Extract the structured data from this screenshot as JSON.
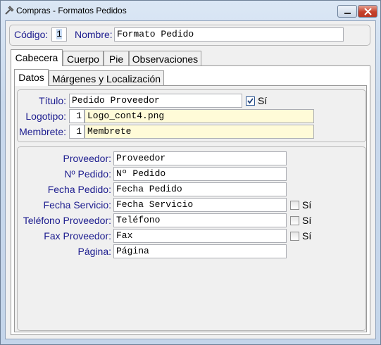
{
  "window": {
    "title": "Compras - Formatos Pedidos"
  },
  "header": {
    "codigo_label": "Código:",
    "codigo_value": "1",
    "nombre_label": "Nombre:",
    "nombre_value": "Formato Pedido"
  },
  "main_tabs": [
    "Cabecera",
    "Cuerpo",
    "Pie",
    "Observaciones"
  ],
  "sub_tabs": [
    "Datos",
    "Márgenes y Localización"
  ],
  "datos": {
    "titulo_label": "Título:",
    "titulo_value": "Pedido Proveedor",
    "titulo_check_label": "Sí",
    "titulo_checked": true,
    "logotipo_label": "Logotipo:",
    "logotipo_num": "1",
    "logotipo_value": "Logo_cont4.png",
    "membrete_label": "Membrete:",
    "membrete_num": "1",
    "membrete_value": "Membrete"
  },
  "fields": {
    "proveedor_label": "Proveedor:",
    "proveedor_value": "Proveedor",
    "npedido_label": "Nº Pedido:",
    "npedido_value": "Nº Pedido",
    "fechapedido_label": "Fecha Pedido:",
    "fechapedido_value": "Fecha Pedido",
    "fechaservicio_label": "Fecha Servicio:",
    "fechaservicio_value": "Fecha Servicio",
    "fechaservicio_check": "Sí",
    "telefono_label": "Teléfono Proveedor:",
    "telefono_value": "Teléfono",
    "telefono_check": "Sí",
    "fax_label": "Fax Proveedor:",
    "fax_value": "Fax",
    "fax_check": "Sí",
    "pagina_label": "Página:",
    "pagina_value": "Página"
  }
}
